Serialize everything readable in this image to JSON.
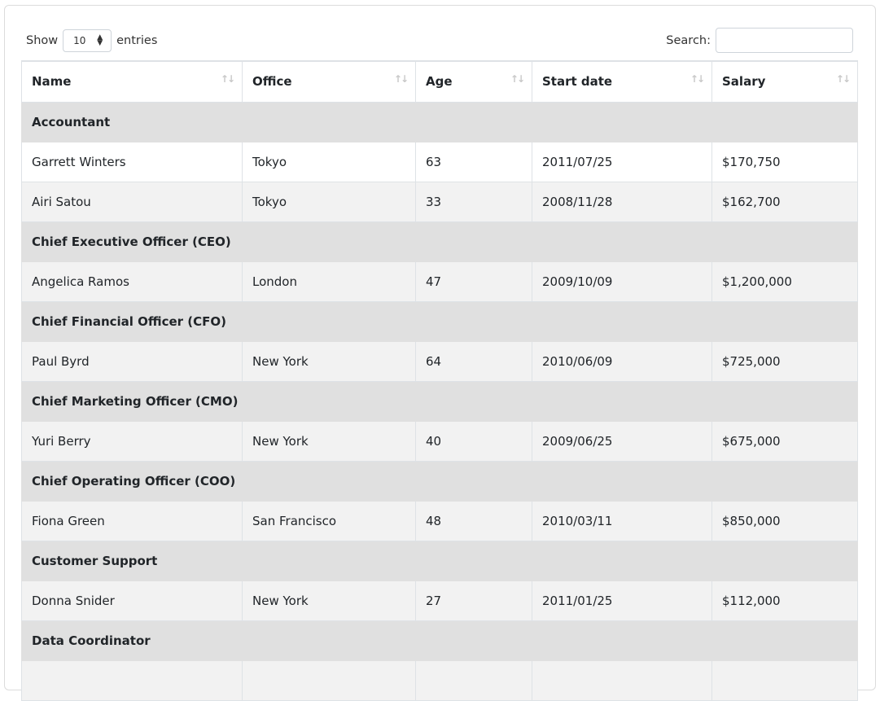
{
  "length": {
    "show_label": "Show",
    "value": "10",
    "entries_label": "entries"
  },
  "search": {
    "label": "Search:",
    "value": ""
  },
  "columns": [
    "Name",
    "Office",
    "Age",
    "Start date",
    "Salary"
  ],
  "groups": [
    {
      "title": "Accountant",
      "rows": [
        [
          "Garrett Winters",
          "Tokyo",
          "63",
          "2011/07/25",
          "$170,750"
        ],
        [
          "Airi Satou",
          "Tokyo",
          "33",
          "2008/11/28",
          "$162,700"
        ]
      ]
    },
    {
      "title": "Chief Executive Officer (CEO)",
      "rows": [
        [
          "Angelica Ramos",
          "London",
          "47",
          "2009/10/09",
          "$1,200,000"
        ]
      ]
    },
    {
      "title": "Chief Financial Officer (CFO)",
      "rows": [
        [
          "Paul Byrd",
          "New York",
          "64",
          "2010/06/09",
          "$725,000"
        ]
      ]
    },
    {
      "title": "Chief Marketing Officer (CMO)",
      "rows": [
        [
          "Yuri Berry",
          "New York",
          "40",
          "2009/06/25",
          "$675,000"
        ]
      ]
    },
    {
      "title": "Chief Operating Officer (COO)",
      "rows": [
        [
          "Fiona Green",
          "San Francisco",
          "48",
          "2010/03/11",
          "$850,000"
        ]
      ]
    },
    {
      "title": "Customer Support",
      "rows": [
        [
          "Donna Snider",
          "New York",
          "27",
          "2011/01/25",
          "$112,000"
        ]
      ]
    },
    {
      "title": "Data Coordinator",
      "rows": [
        [
          "",
          "",
          "",
          "",
          ""
        ]
      ]
    }
  ]
}
